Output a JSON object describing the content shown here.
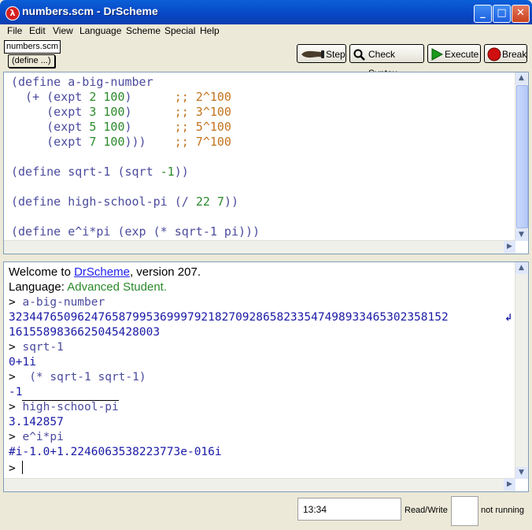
{
  "window": {
    "title": "numbers.scm - DrScheme",
    "app_icon": "lambda-icon",
    "controls": {
      "minimize": "_",
      "maximize": "□",
      "close": "✕"
    }
  },
  "menu": [
    "File",
    "Edit",
    "View",
    "Language",
    "Scheme",
    "Special",
    "Help"
  ],
  "toolbar": {
    "file_tab": "numbers.scm",
    "define_popup": "(define ...)",
    "buttons": {
      "step": "Step",
      "check_syntax": "Check Syntax",
      "execute": "Execute",
      "break": "Break"
    }
  },
  "definitions": {
    "lines": [
      "(define a-big-number",
      "  (+ (expt 2 100)      ;; 2^100",
      "     (expt 3 100)      ;; 3^100",
      "     (expt 5 100)      ;; 5^100",
      "     (expt 7 100)))    ;; 7^100",
      "",
      "(define sqrt-1 (sqrt -1))",
      "",
      "(define high-school-pi (/ 22 7))",
      "",
      "(define e^i*pi (exp (* sqrt-1 pi)))"
    ]
  },
  "interactions": {
    "welcome_prefix": "Welcome to ",
    "welcome_link": "DrScheme",
    "welcome_suffix": ", version 207.",
    "language_label": "Language: ",
    "language_value": "Advanced Student.",
    "entries": [
      {
        "prompt": "> ",
        "input": "a-big-number",
        "output": "3234476509624765879953699979218270928658233547498933465302358152",
        "output_cont": "1615589836625045428003"
      },
      {
        "prompt": "> ",
        "input": "sqrt-1",
        "output": "0+1i"
      },
      {
        "prompt": "> ",
        "input": " (* sqrt-1 sqrt-1)",
        "output": "-1"
      },
      {
        "prompt": "> ",
        "input": "high-school-pi",
        "output": "3.142857"
      },
      {
        "prompt": "> ",
        "input": "e^i*pi",
        "output": "#i-1.0+1.2246063538223773e-016i"
      }
    ],
    "final_prompt": "> "
  },
  "status": {
    "position": "13:34",
    "mode": "Read/Write",
    "running": "not running"
  },
  "colors": {
    "keyword": "#4b4b9e",
    "number": "#2b8a2b",
    "comment": "#c2741f",
    "output": "#1a1aa6",
    "link": "#2222ee",
    "language": "#2b8a2b"
  }
}
